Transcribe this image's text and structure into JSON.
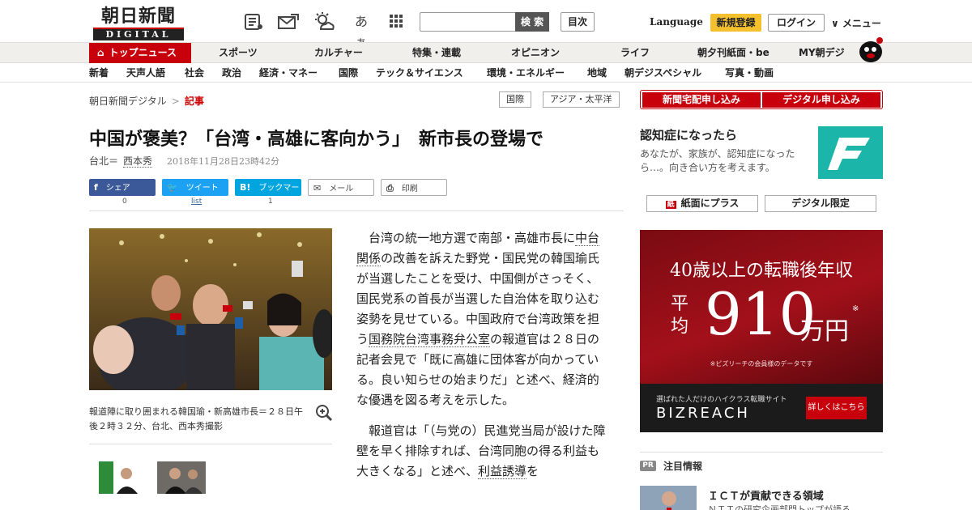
{
  "header": {
    "logo_main": "朝日新聞",
    "logo_sub": "DIGITAL",
    "search_placeholder": "",
    "search_button": "検 索",
    "toc_button": "目次",
    "language": "Language",
    "register_button": "新規登録",
    "login_button": "ログイン",
    "menu_button": "∨ メニュー",
    "tool_icons": [
      "newspaper-icon",
      "mail-icon",
      "weather-icon",
      "font-size-icon",
      "grid-icon"
    ],
    "font_size_label": "あぁ"
  },
  "nav_primary": {
    "top_news": "トップニュース",
    "items": [
      "スポーツ",
      "カルチャー",
      "特集・連載",
      "オピニオン",
      "ライフ",
      "朝夕刊紙面・be",
      "MY朝デジ"
    ]
  },
  "nav_secondary": {
    "items": [
      "新着",
      "天声人語",
      "社会",
      "政治",
      "経済・マネー",
      "国際",
      "テック＆サイエンス",
      "環境・エネルギー",
      "地域",
      "朝デジスペシャル",
      "写真・動画"
    ]
  },
  "breadcrumb": {
    "home": "朝日新聞デジタル",
    "separator": ">",
    "current": "記事"
  },
  "tags": [
    "国際",
    "アジア・太平洋"
  ],
  "article": {
    "headline": "中国が褒美？「台湾・高雄に客向かう」　新市長の登場で",
    "location": "台北＝",
    "author": "西本秀",
    "date": "2018年11月28日23時42分",
    "share": {
      "facebook_label": "シェア",
      "facebook_count": "0",
      "twitter_label": "ツイート",
      "twitter_count": "list",
      "hatena_label": "ブックマーク",
      "hatena_count": "1",
      "mail_label": "メール",
      "print_label": "印刷"
    },
    "photo_caption": "報道陣に取り囲まれる韓国瑜・新高雄市長＝２８日午後２時３２分、台北、西本秀撮影",
    "paragraph1_a": "台湾の統一地方選で南部・高雄市長に",
    "paragraph1_kw1": "中台関係",
    "paragraph1_b": "の改善を訴えた野党・国民党の韓国瑜氏が当選したことを受け、中国側がさっそく、国民党系の首長が当選した自治体を取り込む姿勢を見せている。中国政府で台湾政策を担う",
    "paragraph1_kw2": "国務院台湾事務弁公室",
    "paragraph1_c": "の報道官は２８日の記者会見で「既に高雄に団体客が向かっている。良い知らせの始まりだ」と述べ、経済的な優遇を図る考えを示した。",
    "paragraph2_a": "報道官は「（与党の）民進党当局が設けた障壁を早く排除すれば、台湾同胞の得る利益も大きくなる」と述べ、",
    "paragraph2_kw": "利益誘導",
    "paragraph2_b": "を"
  },
  "sidebar": {
    "subscribe_paper": "新聞宅配申し込み",
    "subscribe_digital": "デジタル申し込み",
    "promo_title": "認知症になったら",
    "promo_desc": "あなたが、家族が、認知症になったら…。向き合い方を考えます。",
    "paper_plus": "紙面にプラス",
    "digital_only": "デジタル限定",
    "ad": {
      "headline": "40歳以上の転職後年収",
      "avg": "平均",
      "number": "910",
      "unit": "万円",
      "mark": "※",
      "note": "※ビズリーチの会員様のデータです",
      "tagline": "選ばれた人だけのハイクラス転職サイト",
      "brand": "BIZREACH",
      "cta": "詳しくはこちら"
    },
    "pr_badge": "PR",
    "pr_title": "注目情報",
    "pr_headline": "ＩＣＴが貢献できる領域",
    "pr_sub": "ＮＴＴの研究企画部門トップが語る"
  },
  "colors": {
    "brand_red": "#c7000b",
    "facebook": "#3b5998",
    "twitter": "#1da1f2",
    "hatena": "#00a4de",
    "register_yellow": "#f5c02e",
    "promo_teal": "#1bb6a9"
  }
}
